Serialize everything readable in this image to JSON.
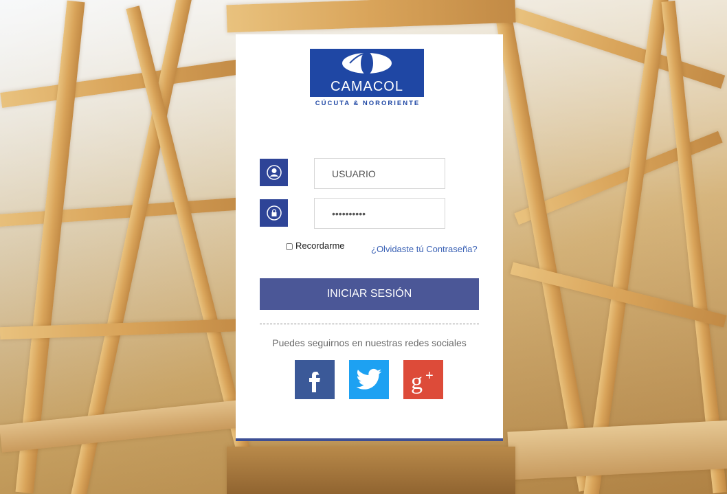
{
  "logo": {
    "name": "CAMACOL",
    "subtitle": "CÚCUTA & NORORIENTE"
  },
  "form": {
    "username_placeholder": "USUARIO",
    "password_value": "••••••••••",
    "remember_label": "Recordarme",
    "remember_checked": false,
    "forgot_label": "¿Olvidaste tú Contraseña?",
    "submit_label": "INICIAR SESIÓN"
  },
  "social": {
    "text": "Puedes seguirnos en nuestras redes sociales",
    "items": [
      {
        "icon": "facebook-icon",
        "color": "#3b5998"
      },
      {
        "icon": "twitter-icon",
        "color": "#1da1f2"
      },
      {
        "icon": "google-plus-icon",
        "color": "#dd4b39"
      }
    ]
  },
  "colors": {
    "brand_blue": "#1f47a4",
    "icon_blue": "#2e4497",
    "button_blue": "#4b5797",
    "link_blue": "#3b62b5"
  }
}
